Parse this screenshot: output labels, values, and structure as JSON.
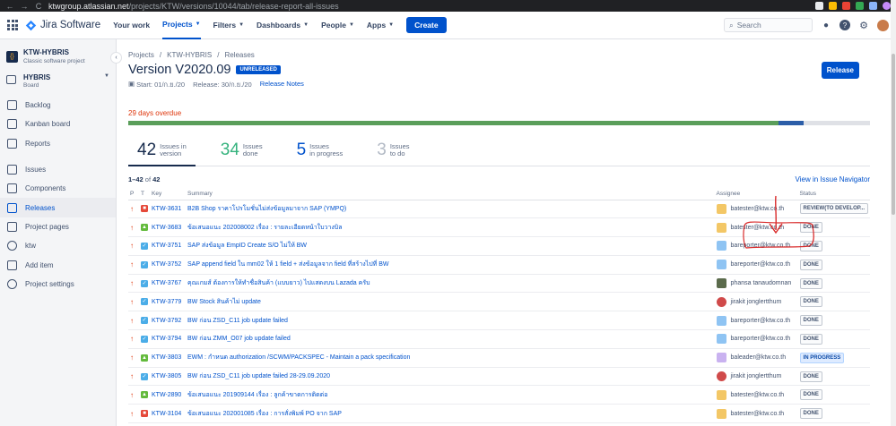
{
  "browser": {
    "url_host": "ktwgroup.atlassian.net",
    "url_path": "/projects/KTW/versions/10044/tab/release-report-all-issues",
    "back": "←",
    "forward": "→",
    "reload": "C"
  },
  "topnav": {
    "product": "Jira Software",
    "items": [
      {
        "label": "Your work",
        "active": false
      },
      {
        "label": "Projects",
        "active": true
      },
      {
        "label": "Filters",
        "active": false
      },
      {
        "label": "Dashboards",
        "active": false
      },
      {
        "label": "People",
        "active": false
      },
      {
        "label": "Apps",
        "active": false
      }
    ],
    "create": "Create",
    "search_placeholder": "Search"
  },
  "sidebar": {
    "project_name": "KTW-HYBRIS",
    "project_type": "Classic software project",
    "board_name": "HYBRIS",
    "board_type": "Board",
    "items_primary": [
      "Backlog",
      "Kanban board",
      "Reports"
    ],
    "items_secondary": [
      "Issues",
      "Components",
      "Releases",
      "Project pages",
      "ktw",
      "Add item",
      "Project settings"
    ],
    "active": "Releases"
  },
  "page": {
    "breadcrumb": [
      "Projects",
      "KTW-HYBRIS",
      "Releases"
    ],
    "title": "Version V2020.09",
    "lozenge": "UNRELEASED",
    "start": "Start: 01/ก.ย./20",
    "release": "Release: 30/ก.ย./20",
    "release_notes": "Release Notes",
    "release_button": "Release",
    "overdue": "29 days overdue",
    "progress": {
      "done": 0.877,
      "in_progress": 0.033,
      "todo": 0.09
    }
  },
  "stats": [
    {
      "num": "42",
      "label1": "Issues in",
      "label2": "version"
    },
    {
      "num": "34",
      "label1": "Issues",
      "label2": "done"
    },
    {
      "num": "5",
      "label1": "Issues",
      "label2": "in progress"
    },
    {
      "num": "3",
      "label1": "Issues",
      "label2": "to do"
    }
  ],
  "list": {
    "range": "1–42",
    "of": "of",
    "total": "42",
    "navigator_link": "View in Issue Navigator",
    "headers": {
      "p": "P",
      "t": "T",
      "key": "Key",
      "summary": "Summary",
      "assignee": "Assignee",
      "status": "Status"
    },
    "rows": [
      {
        "type": "bug",
        "key": "KTW-3631",
        "summary": "B2B Shop ราคาโปรโมชั่นไม่ส่งข้อมูลมาจาก SAP (YMPQ)",
        "assignee": "batester@ktw.co.th",
        "av": "yellow",
        "status": "REVIEW(TO DEVELOP...",
        "prog": false
      },
      {
        "type": "story",
        "key": "KTW-3683",
        "summary": "ข้อเสนอแนะ 202008002 เรื่อง : รายละเอียดหน้าใบวางบิล",
        "assignee": "batester@ktw.co.th",
        "av": "yellow",
        "status": "DONE",
        "prog": false
      },
      {
        "type": "task",
        "key": "KTW-3751",
        "summary": "SAP ส่งข้อมูล EmpID Create S/O ไม่ให้ BW",
        "assignee": "bareporter@ktw.co.th",
        "av": "blue",
        "status": "DONE",
        "prog": false
      },
      {
        "type": "task",
        "key": "KTW-3752",
        "summary": "SAP append field ใน mm02 ให้ 1 field + ส่งข้อมูลจาก field ที่สร้างไปที่ BW",
        "assignee": "bareporter@ktw.co.th",
        "av": "blue",
        "status": "DONE",
        "prog": false
      },
      {
        "type": "task",
        "key": "KTW-3767",
        "summary": "คุณเกมส์ ต้องการให้ทำชื่อสินค้า (แบบยาว) ไปแสดงบน Lazada ครับ",
        "assignee": "phansa tanaudomnan",
        "av": "photo",
        "status": "DONE",
        "prog": false
      },
      {
        "type": "task",
        "key": "KTW-3779",
        "summary": "BW Stock สินค้าไม่ update",
        "assignee": "jirakit jonglertthum",
        "av": "red",
        "status": "DONE",
        "prog": false
      },
      {
        "type": "task",
        "key": "KTW-3792",
        "summary": "BW ก่อน ZSD_C11 job update failed",
        "assignee": "bareporter@ktw.co.th",
        "av": "blue",
        "status": "DONE",
        "prog": false
      },
      {
        "type": "task",
        "key": "KTW-3794",
        "summary": "BW ก่อน ZMM_O07 job update failed",
        "assignee": "bareporter@ktw.co.th",
        "av": "blue",
        "status": "DONE",
        "prog": false
      },
      {
        "type": "story",
        "key": "KTW-3803",
        "summary": "EWM : กำหนด authorization /SCWM/PACKSPEC - Maintain a pack specification",
        "assignee": "baleader@ktw.co.th",
        "av": "purple",
        "status": "IN PROGRESS",
        "prog": true
      },
      {
        "type": "task",
        "key": "KTW-3805",
        "summary": "BW ก่อน ZSD_C11 job update failed 28-29.09.2020",
        "assignee": "jirakit jonglertthum",
        "av": "red",
        "status": "DONE",
        "prog": false
      },
      {
        "type": "story",
        "key": "KTW-2890",
        "summary": "ข้อเสนอแนะ 201909144 เรื่อง : ลูกค้าขาดการติดต่อ",
        "assignee": "batester@ktw.co.th",
        "av": "yellow",
        "status": "DONE",
        "prog": false
      },
      {
        "type": "bug",
        "key": "KTW-3104",
        "summary": "ข้อเสนอแนะ 202001085 เรื่อง : การสั่งพิมพ์ PO จาก SAP",
        "assignee": "batester@ktw.co.th",
        "av": "yellow",
        "status": "DONE",
        "prog": false
      }
    ]
  },
  "colors": {
    "brand": "#0052cc",
    "done": "#5a9e5a",
    "in_progress": "#2c5ea8",
    "overdue": "#de350b",
    "annotation": "#d92b2b"
  }
}
